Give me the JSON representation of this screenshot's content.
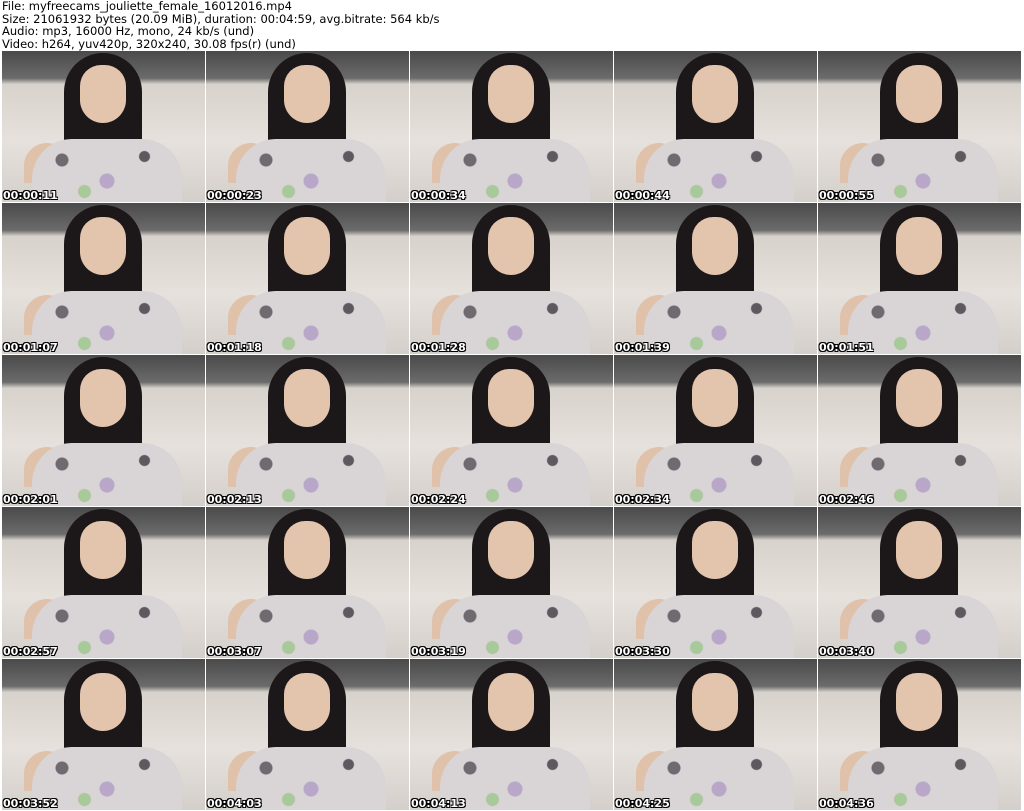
{
  "header": {
    "file_line": "File: myfreecams_jouliette_female_16012016.mp4",
    "size_line": "Size: 21061932 bytes (20.09 MiB), duration: 00:04:59, avg.bitrate: 564 kb/s",
    "audio_line": "Audio: mp3, 16000 Hz, mono, 24 kb/s (und)",
    "video_line": "Video: h264, yuv420p, 320x240, 30.08 fps(r) (und)"
  },
  "timestamps": [
    "00:00:11",
    "00:00:23",
    "00:00:34",
    "00:00:44",
    "00:00:55",
    "00:01:07",
    "00:01:18",
    "00:01:28",
    "00:01:39",
    "00:01:51",
    "00:02:01",
    "00:02:13",
    "00:02:24",
    "00:02:34",
    "00:02:46",
    "00:02:57",
    "00:03:07",
    "00:03:19",
    "00:03:30",
    "00:03:40",
    "00:03:52",
    "00:04:03",
    "00:04:13",
    "00:04:25",
    "00:04:36"
  ]
}
